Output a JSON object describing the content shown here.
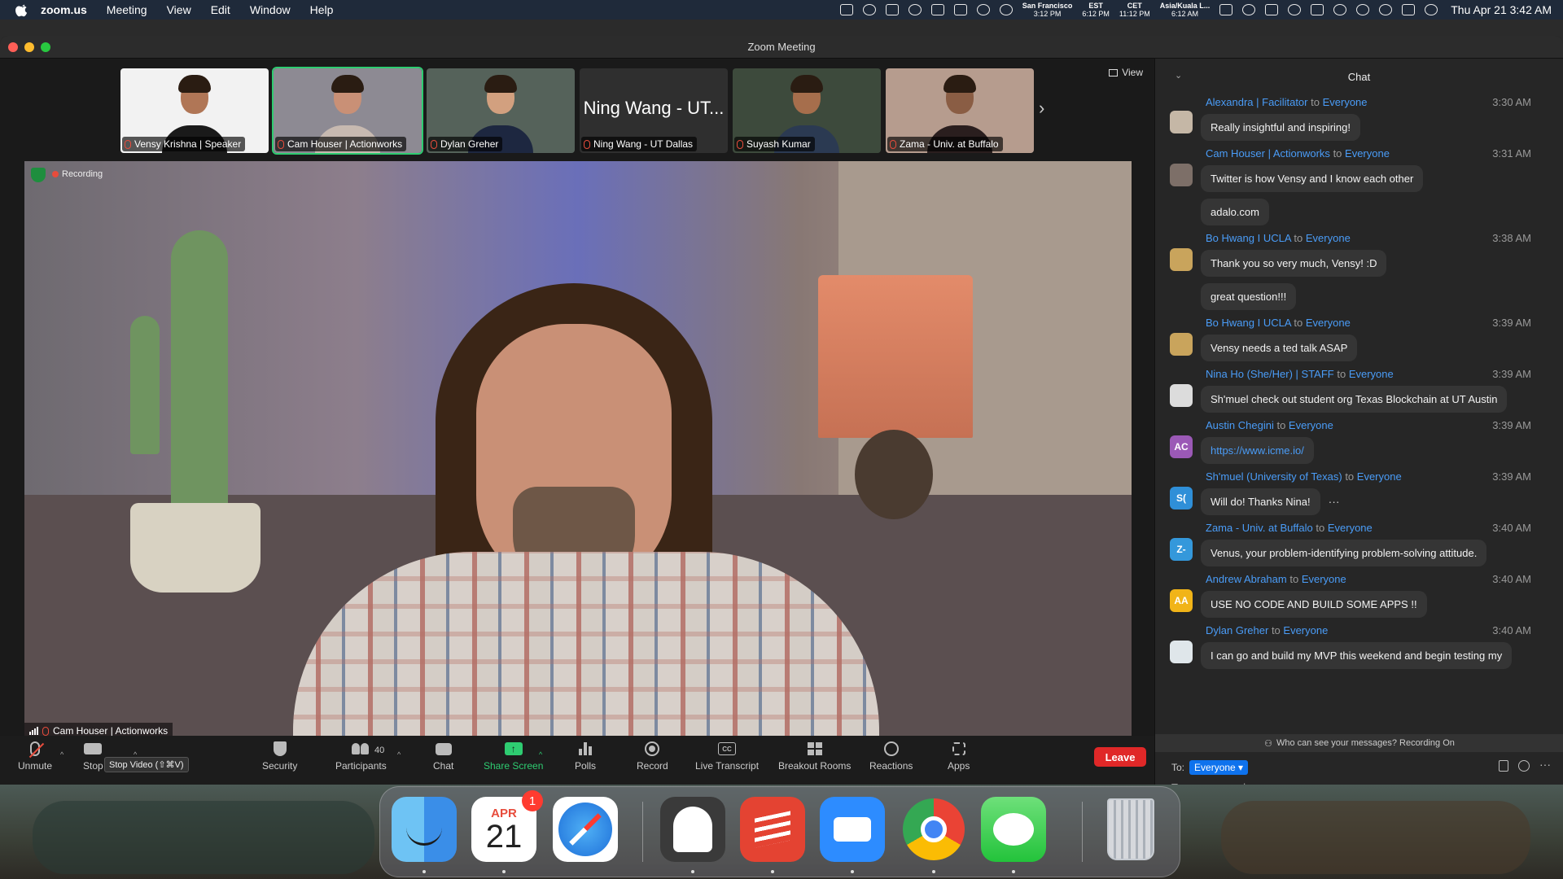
{
  "menubar": {
    "app": "zoom.us",
    "items": [
      "Meeting",
      "View",
      "Edit",
      "Window",
      "Help"
    ],
    "timezones": [
      {
        "city": "San Francisco",
        "time": "3:12 PM"
      },
      {
        "city": "EST",
        "time": "6:12 PM"
      },
      {
        "city": "CET",
        "time": "11:12 PM"
      },
      {
        "city": "Asia/Kuala L...",
        "time": "6:12 AM"
      }
    ],
    "clock": "Thu Apr 21  3:42 AM"
  },
  "window": {
    "title": "Zoom Meeting",
    "view_label": "View"
  },
  "participants": [
    {
      "name": "Vensy Krishna | Speaker",
      "video": true,
      "active": false,
      "bg": "#f2f2f2",
      "shirt": "#1a1a1a",
      "skin": "#b07656"
    },
    {
      "name": "Cam Houser | Actionworks",
      "video": true,
      "active": true,
      "bg": "#8d8a93",
      "shirt": "#c7b9b0",
      "skin": "#c99076"
    },
    {
      "name": "Dylan Greher",
      "video": true,
      "active": false,
      "bg": "#55625a",
      "shirt": "#1d2740",
      "skin": "#d2a07f"
    },
    {
      "name": "Ning Wang - UT Dallas",
      "video": false,
      "display": "Ning Wang - UT...",
      "active": false
    },
    {
      "name": "Suyash Kumar",
      "video": true,
      "active": false,
      "bg": "#3d4a3c",
      "shirt": "#2b3a52",
      "skin": "#a66e4c"
    },
    {
      "name": "Zama - Univ. at Buffalo",
      "video": true,
      "active": false,
      "bg": "#b69c8e",
      "shirt": "#2a1e1e",
      "skin": "#8a5d44"
    }
  ],
  "main_video": {
    "recording_label": "Recording",
    "speaker": "Cam Houser | Actionworks"
  },
  "toolbar": {
    "unmute": "Unmute",
    "stop_video": "Stop",
    "tooltip": "Stop Video (⇧⌘V)",
    "security": "Security",
    "participants": "Participants",
    "participant_count": "40",
    "chat": "Chat",
    "share_screen": "Share Screen",
    "polls": "Polls",
    "record": "Record",
    "live_transcript": "Live Transcript",
    "cc": "CC",
    "breakout_rooms": "Breakout Rooms",
    "reactions": "Reactions",
    "apps": "Apps",
    "leave": "Leave"
  },
  "chat": {
    "title": "Chat",
    "to_word": "to",
    "messages": [
      {
        "from": "Alexandra | Facilitator",
        "to": "Everyone",
        "time": "3:30 AM",
        "avatar_initials": "",
        "avatar_color": "#c5b7a6",
        "texts": [
          "Really insightful and inspiring!"
        ]
      },
      {
        "from": "Cam Houser | Actionworks",
        "to": "Everyone",
        "time": "3:31 AM",
        "avatar_initials": "",
        "avatar_color": "#7d6f68",
        "texts": [
          "Twitter is how Vensy and I know each other",
          "adalo.com"
        ]
      },
      {
        "from": "Bo Hwang I UCLA",
        "to": "Everyone",
        "time": "3:38 AM",
        "avatar_initials": "",
        "avatar_color": "#c9a45c",
        "texts": [
          "Thank you so very much, Vensy! :D",
          "great question!!!"
        ]
      },
      {
        "from": "Bo Hwang I UCLA",
        "to": "Everyone",
        "time": "3:39 AM",
        "avatar_initials": "",
        "avatar_color": "#c9a45c",
        "texts": [
          "Vensy needs a ted talk ASAP"
        ]
      },
      {
        "from": "Nina Ho (She/Her) | STAFF",
        "to": "Everyone",
        "time": "3:39 AM",
        "avatar_initials": "",
        "avatar_color": "#dcdcdc",
        "texts": [
          "Sh'muel check out student org Texas Blockchain at UT Austin"
        ]
      },
      {
        "from": "Austin Chegini",
        "to": "Everyone",
        "time": "3:39 AM",
        "avatar_initials": "AC",
        "avatar_color": "#9b59b6",
        "texts": [
          "https://www.icme.io/"
        ],
        "link": true
      },
      {
        "from": "Sh'muel (University of Texas)",
        "to": "Everyone",
        "time": "3:39 AM",
        "avatar_initials": "S(",
        "avatar_color": "#2f8fd8",
        "texts": [
          "Will do! Thanks Nina!"
        ],
        "more": "···"
      },
      {
        "from": "Zama - Univ. at Buffalo",
        "to": "Everyone",
        "time": "3:40 AM",
        "avatar_initials": "Z-",
        "avatar_color": "#3498db",
        "texts": [
          "Venus, your problem-identifying problem-solving attitude."
        ]
      },
      {
        "from": "Andrew Abraham",
        "to": "Everyone",
        "time": "3:40 AM",
        "avatar_initials": "AA",
        "avatar_color": "#f1b418",
        "texts": [
          "USE NO CODE AND BUILD SOME APPS !!"
        ]
      },
      {
        "from": "Dylan Greher",
        "to": "Everyone",
        "time": "3:40 AM",
        "avatar_initials": "",
        "avatar_color": "#dfe6ea",
        "texts": [
          "I can go and build my MVP this weekend and begin testing my"
        ]
      }
    ],
    "notice": "Who can see your messages? Recording On",
    "to_label": "To:",
    "recipient": "Everyone",
    "placeholder": "Type message here..."
  },
  "dock": {
    "calendar_month": "APR",
    "calendar_day": "21",
    "calendar_badge": "1",
    "apps": [
      "Finder",
      "Calendar",
      "Safari",
      "Bear",
      "Todoist",
      "Zoom",
      "Chrome",
      "Messages",
      "Trash"
    ]
  }
}
